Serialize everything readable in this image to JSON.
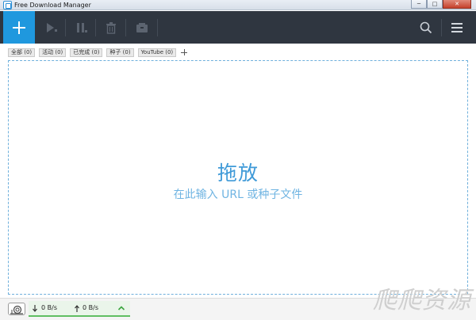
{
  "window": {
    "title": "Free Download Manager",
    "controls": {
      "minimize": "─",
      "maximize": "□",
      "close": "✕"
    }
  },
  "toolbar": {
    "add_icon": "plus-icon",
    "icons": [
      "play-icon",
      "pause-icon",
      "trash-icon",
      "archive-icon",
      "search-icon",
      "menu-icon"
    ],
    "accent_color": "#1f98de",
    "background_color": "#2f3640"
  },
  "tabs": [
    {
      "label": "全部 (0)"
    },
    {
      "label": "活动 (0)"
    },
    {
      "label": "已完成 (0)"
    },
    {
      "label": "种子 (0)"
    },
    {
      "label": "YouTube (0)"
    }
  ],
  "dropzone": {
    "title": "拖放",
    "subtitle": "在此输入 URL 或种子文件",
    "border_color": "#6fb0dc"
  },
  "status": {
    "download_speed": "0 B/s",
    "upload_speed": "0 B/s",
    "download_icon": "arrow-down-icon",
    "upload_icon": "arrow-up-icon",
    "snail_icon": "snail-icon",
    "expand_icon": "chevron-up-icon",
    "indicator_color": "#5fbf62"
  },
  "watermark": {
    "text": "爬爬资源"
  }
}
